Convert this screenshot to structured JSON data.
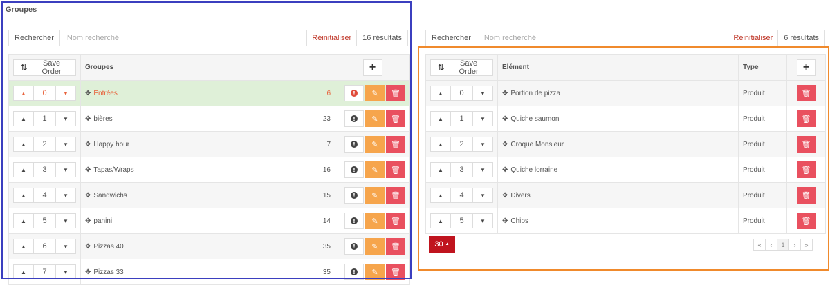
{
  "left": {
    "title": "Groupes",
    "search": {
      "label": "Rechercher",
      "placeholder": "Nom recherché",
      "reset": "Réinitialiser",
      "count": "16 résultats"
    },
    "save_order": "Save Order",
    "headers": {
      "name": "Groupes"
    },
    "rows": [
      {
        "order": "0",
        "name": "Entrées",
        "count": "6",
        "active": true
      },
      {
        "order": "1",
        "name": "bières",
        "count": "23"
      },
      {
        "order": "2",
        "name": "Happy hour",
        "count": "7"
      },
      {
        "order": "3",
        "name": "Tapas/Wraps",
        "count": "16"
      },
      {
        "order": "4",
        "name": "Sandwichs",
        "count": "15"
      },
      {
        "order": "5",
        "name": "panini",
        "count": "14"
      },
      {
        "order": "6",
        "name": "Pizzas 40",
        "count": "35"
      },
      {
        "order": "7",
        "name": "Pizzas 33",
        "count": "35"
      }
    ]
  },
  "right": {
    "search": {
      "label": "Rechercher",
      "placeholder": "Nom recherché",
      "reset": "Réinitialiser",
      "count": "6 résultats"
    },
    "save_order": "Save Order",
    "headers": {
      "name": "Elément",
      "type": "Type"
    },
    "rows": [
      {
        "order": "0",
        "name": "Portion de pizza",
        "type": "Produit"
      },
      {
        "order": "1",
        "name": "Quiche saumon",
        "type": "Produit"
      },
      {
        "order": "2",
        "name": "Croque Monsieur",
        "type": "Produit"
      },
      {
        "order": "3",
        "name": "Quiche lorraine",
        "type": "Produit"
      },
      {
        "order": "4",
        "name": "Divers",
        "type": "Produit"
      },
      {
        "order": "5",
        "name": "Chips",
        "type": "Produit"
      }
    ],
    "per_page": "30",
    "pagination": [
      "«",
      "‹",
      "1",
      "›",
      "»"
    ],
    "current_page": "1"
  },
  "colors": {
    "left_frame": "#3b3fbf",
    "right_frame": "#f08a2c",
    "active_row": "#dff0d8",
    "danger": "#e9505f",
    "warning": "#f6a54c",
    "per_page_bg": "#c0141e"
  },
  "icons": {
    "save_order": "sort-icon",
    "add": "plus-icon",
    "up": "caret-up-icon",
    "down": "caret-down-icon",
    "move": "move-icon",
    "info": "info-icon",
    "edit": "pencil-icon",
    "delete": "trash-icon"
  }
}
